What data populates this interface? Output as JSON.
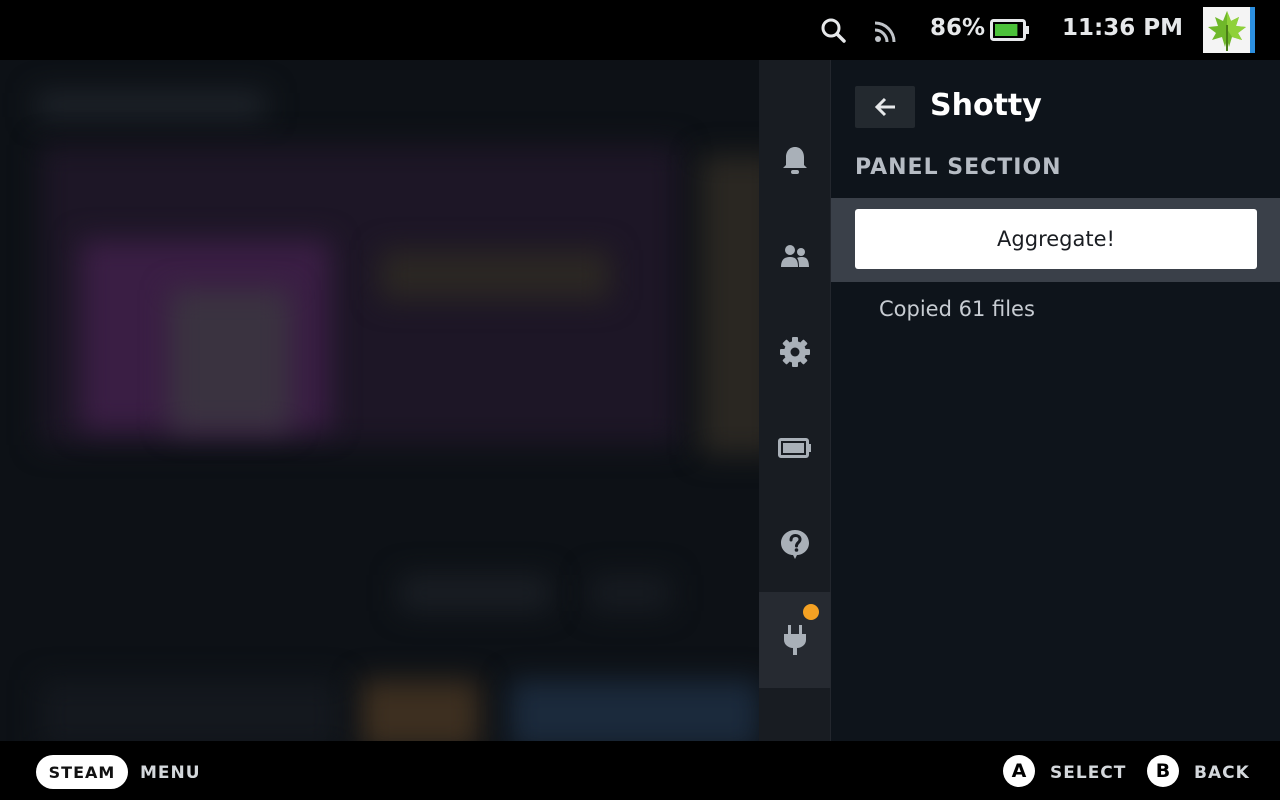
{
  "status_bar": {
    "battery_percent": "86%",
    "battery_level": 0.86,
    "time": "11:36 PM",
    "icons": [
      "search-icon",
      "wifi-icon",
      "battery-icon",
      "avatar-maple-leaf"
    ]
  },
  "sidebar": {
    "tabs": [
      {
        "name": "notifications",
        "icon": "bell-icon"
      },
      {
        "name": "friends",
        "icon": "friends-icon"
      },
      {
        "name": "settings",
        "icon": "gear-icon"
      },
      {
        "name": "performance",
        "icon": "battery-tab-icon"
      },
      {
        "name": "help",
        "icon": "help-icon"
      },
      {
        "name": "plugins",
        "icon": "plug-icon",
        "active": true,
        "badge": true
      }
    ]
  },
  "panel": {
    "title": "Shotty",
    "section_title": "PANEL SECTION",
    "button_label": "Aggregate!",
    "status": "Copied 61 files"
  },
  "footer": {
    "steam_label": "STEAM",
    "menu_label": "MENU",
    "a_key": "A",
    "select_label": "SELECT",
    "b_key": "B",
    "back_label": "BACK"
  },
  "colors": {
    "accent_badge": "#f4a123",
    "battery_fill": "#4cc23a",
    "panel_bg": "#0e141b"
  }
}
